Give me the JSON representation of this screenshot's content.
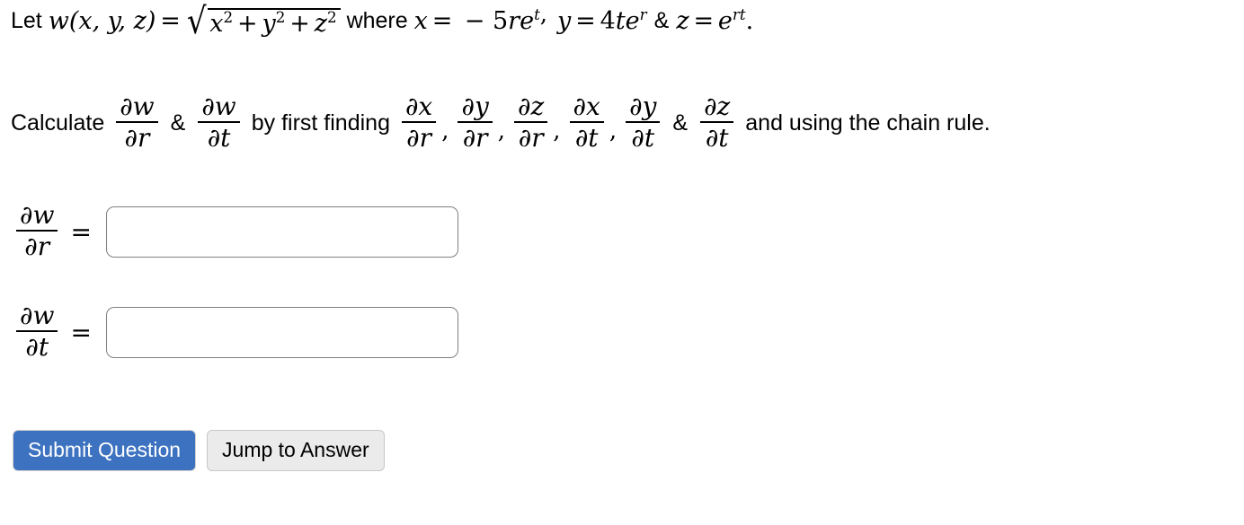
{
  "problem": {
    "line1": {
      "lead_text": "Let",
      "function_name": "w",
      "function_args": "(x, y, z)",
      "equals": "=",
      "radicand": "x² + y² + z²",
      "where_text": "where",
      "x_label": "x",
      "x_equals": "=",
      "x_value": "− 5reᵗ",
      "comma1": ",",
      "y_label": "y",
      "y_equals": "=",
      "y_value": "4teʳ",
      "ampersand": "&",
      "z_label": "z",
      "z_equals": "=",
      "z_value": "eʳᵗ",
      "period": "."
    },
    "line2": {
      "lead_text": "Calculate",
      "target1_num": "∂w",
      "target1_den": "∂r",
      "ampersand1": "&",
      "target2_num": "∂w",
      "target2_den": "∂t",
      "middle_text": "by first finding",
      "partials": [
        {
          "num": "∂x",
          "den": "∂r",
          "sep": ","
        },
        {
          "num": "∂y",
          "den": "∂r",
          "sep": ","
        },
        {
          "num": "∂z",
          "den": "∂r",
          "sep": ","
        },
        {
          "num": "∂x",
          "den": "∂t",
          "sep": ","
        },
        {
          "num": "∂y",
          "den": "∂t",
          "sep": "&"
        },
        {
          "num": "∂z",
          "den": "∂t",
          "sep": ""
        }
      ],
      "ampersand2": "&",
      "tail_text": "and using the chain rule."
    }
  },
  "answers": [
    {
      "label_num": "∂w",
      "label_den": "∂r",
      "equals": "=",
      "value": "",
      "placeholder": ""
    },
    {
      "label_num": "∂w",
      "label_den": "∂t",
      "equals": "=",
      "value": "",
      "placeholder": ""
    }
  ],
  "buttons": {
    "submit_label": "Submit Question",
    "jump_label": "Jump to Answer",
    "submit_color": "#3d72c0",
    "jump_color": "#ebebeb"
  }
}
